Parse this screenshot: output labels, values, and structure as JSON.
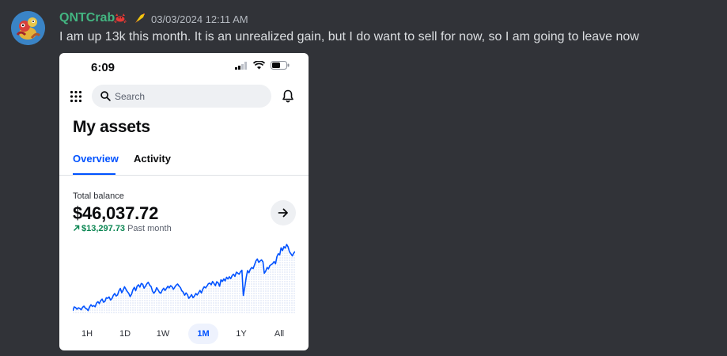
{
  "message": {
    "username": "QNTCrab",
    "timestamp": "03/03/2024 12:11 AM",
    "text": "I am up 13k this month. It is an unrealized gain, but I do want to sell for now, so I am going to leave now",
    "username_color": "#43b581",
    "icons": [
      "crab-emoji-icon",
      "rocket-role-icon"
    ]
  },
  "screenshot": {
    "status_time": "6:09",
    "search_placeholder": "Search",
    "title": "My assets",
    "tabs": [
      "Overview",
      "Activity"
    ],
    "active_tab": "Overview",
    "balance_label": "Total balance",
    "balance_value": "$46,037.72",
    "change_amount": "$13,297.73",
    "change_period": "Past month",
    "ranges": [
      "1H",
      "1D",
      "1W",
      "1M",
      "1Y",
      "All"
    ],
    "active_range": "1M",
    "accent_color": "#0052ff",
    "gain_color": "#098551"
  },
  "chart_data": {
    "type": "line",
    "title": "",
    "xlabel": "",
    "ylabel": "",
    "values": [
      33.1,
      34.5,
      34.3,
      33.7,
      34.2,
      34.0,
      33.5,
      34.4,
      34.8,
      34.1,
      33.8,
      33.2,
      34.5,
      35.3,
      34.7,
      35.0,
      34.6,
      35.9,
      36.4,
      35.7,
      36.8,
      37.3,
      36.2,
      36.5,
      37.8,
      37.6,
      38.1,
      37.0,
      37.5,
      38.7,
      39.3,
      38.4,
      38.8,
      40.2,
      41.1,
      39.6,
      40.5,
      41.7,
      40.8,
      40.0,
      39.4,
      38.2,
      39.0,
      40.6,
      41.5,
      40.3,
      41.9,
      42.4,
      41.6,
      42.9,
      42.6,
      41.2,
      41.9,
      42.8,
      43.3,
      42.3,
      41.8,
      40.2,
      39.4,
      40.1,
      41.4,
      40.6,
      39.7,
      39.4,
      40.5,
      41.2,
      40.4,
      41.1,
      41.9,
      41.3,
      42.1,
      41.7,
      40.8,
      41.6,
      42.3,
      42.7,
      42.0,
      41.4,
      40.3,
      39.8,
      38.7,
      39.5,
      38.9,
      37.6,
      38.2,
      38.9,
      37.8,
      38.4,
      39.3,
      38.8,
      39.6,
      40.4,
      39.5,
      40.9,
      41.7,
      41.3,
      42.0,
      42.8,
      43.0,
      42.4,
      43.6,
      42.9,
      42.1,
      43.5,
      43.1,
      41.9,
      44.2,
      43.6,
      44.5,
      43.8,
      45.1,
      44.5,
      45.3,
      44.6,
      45.7,
      46.2,
      45.4,
      46.9,
      46.6,
      46.2,
      47.1,
      47.6,
      38.6,
      41.5,
      44.8,
      47.5,
      46.7,
      47.9,
      48.6,
      48.2,
      49.5,
      50.9,
      51.6,
      50.4,
      50.9,
      51.3,
      50.6,
      46.5,
      47.3,
      48.6,
      48.1,
      49.3,
      49.6,
      50.0,
      50.7,
      49.9,
      52.4,
      53.5,
      53.1,
      55.6,
      54.6,
      56.0,
      55.5,
      56.8,
      55.9,
      54.2,
      53.5,
      52.7,
      53.7,
      54.3
    ]
  }
}
